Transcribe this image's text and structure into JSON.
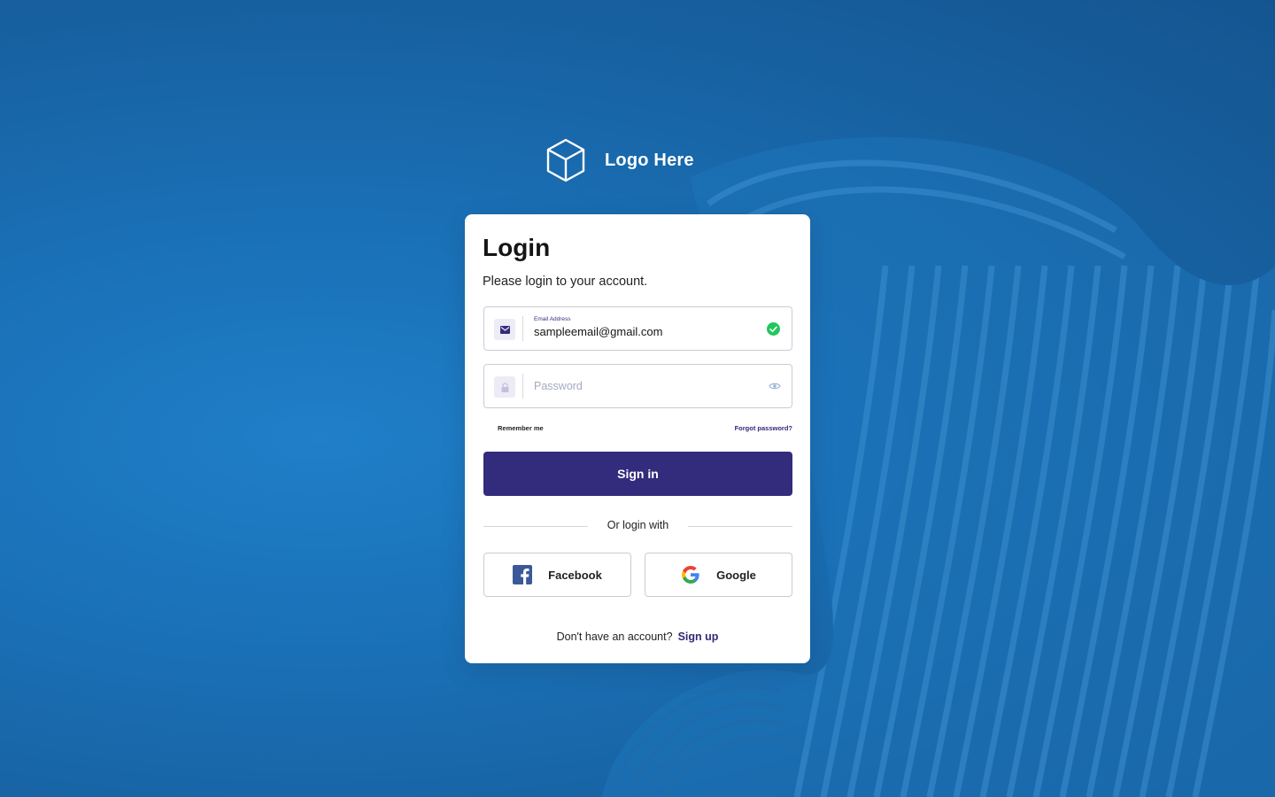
{
  "logo": {
    "text": "Logo Here",
    "icon": "cube-icon"
  },
  "login": {
    "title": "Login",
    "subtitle": "Please login to your account.",
    "email": {
      "label": "Email Address",
      "value": "sampleemail@gmail.com",
      "icon": "envelope-icon",
      "status_icon": "check-circle-icon"
    },
    "password": {
      "placeholder": "Password",
      "value": "",
      "icon": "lock-icon",
      "toggle_icon": "eye-icon"
    },
    "remember_label": "Remember me",
    "forgot_label": "Forgot password?",
    "signin_label": "Sign in",
    "divider_text": "Or login with",
    "social": {
      "facebook_label": "Facebook",
      "google_label": "Google"
    },
    "signup_prompt": "Don't have an account?",
    "signup_label": "Sign up"
  },
  "colors": {
    "background": "#1a6eb3",
    "primary": "#332b7c",
    "success": "#22c55e",
    "facebook": "#3b5998"
  }
}
